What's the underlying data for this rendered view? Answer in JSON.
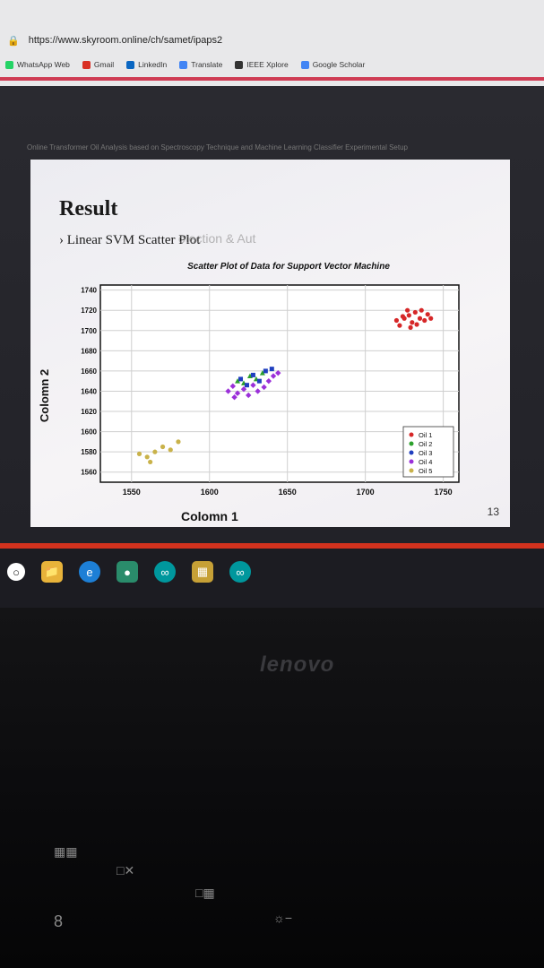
{
  "browser": {
    "url": "https://www.skyroom.online/ch/samet/ipaps2",
    "bookmarks": [
      {
        "label": "WhatsApp Web",
        "color": "#25d366"
      },
      {
        "label": "Gmail",
        "color": "#d93025"
      },
      {
        "label": "LinkedIn",
        "color": "#0a66c2"
      },
      {
        "label": "Translate",
        "color": "#4285f4"
      },
      {
        "label": "IEEE Xplore",
        "color": "#333333"
      },
      {
        "label": "Google Scholar",
        "color": "#4285f4"
      }
    ]
  },
  "document": {
    "title": "Online Transformer Oil Analysis based on Spectroscopy Technique and Machine Learning Classifier Experimental Setup"
  },
  "slide": {
    "heading": "Result",
    "bullet": "› Linear SVM Scatter Plot",
    "watermark": "otection & Aut",
    "page_number": "13"
  },
  "chart_data": {
    "type": "scatter",
    "title": "Scatter Plot of Data for Support Vector Machine",
    "xlabel": "Colomn 1",
    "ylabel": "Colomn 2",
    "xlim": [
      1530,
      1760
    ],
    "ylim": [
      1550,
      1745
    ],
    "x_ticks": [
      "1550",
      "1600",
      "1650",
      "1700",
      "1750"
    ],
    "y_ticks": [
      "1560",
      "1580",
      "1600",
      "1620",
      "1640",
      "1660",
      "1680",
      "1700",
      "1720",
      "1740"
    ],
    "grid": true,
    "legend_position": "bottom-right",
    "series": [
      {
        "name": "Oil 1",
        "color": "#d62728",
        "marker": "circle",
        "points": [
          [
            1720,
            1710
          ],
          [
            1725,
            1712
          ],
          [
            1728,
            1715
          ],
          [
            1730,
            1708
          ],
          [
            1722,
            1705
          ],
          [
            1732,
            1718
          ],
          [
            1735,
            1712
          ],
          [
            1738,
            1710
          ],
          [
            1740,
            1716
          ],
          [
            1727,
            1720
          ],
          [
            1733,
            1706
          ],
          [
            1742,
            1712
          ],
          [
            1736,
            1720
          ],
          [
            1724,
            1714
          ],
          [
            1729,
            1703
          ]
        ]
      },
      {
        "name": "Oil 2",
        "color": "#2ca02c",
        "marker": "triangle",
        "points": [
          [
            1618,
            1650
          ],
          [
            1622,
            1648
          ],
          [
            1626,
            1655
          ],
          [
            1630,
            1652
          ],
          [
            1634,
            1658
          ]
        ]
      },
      {
        "name": "Oil 3",
        "color": "#1f3fbf",
        "marker": "square",
        "points": [
          [
            1620,
            1652
          ],
          [
            1628,
            1656
          ],
          [
            1632,
            1650
          ],
          [
            1636,
            1660
          ],
          [
            1624,
            1646
          ],
          [
            1640,
            1662
          ]
        ]
      },
      {
        "name": "Oil 4",
        "color": "#9b30d9",
        "marker": "diamond",
        "points": [
          [
            1612,
            1640
          ],
          [
            1615,
            1645
          ],
          [
            1618,
            1638
          ],
          [
            1622,
            1642
          ],
          [
            1625,
            1636
          ],
          [
            1628,
            1646
          ],
          [
            1631,
            1640
          ],
          [
            1635,
            1644
          ],
          [
            1638,
            1650
          ],
          [
            1641,
            1655
          ],
          [
            1644,
            1658
          ],
          [
            1616,
            1634
          ]
        ]
      },
      {
        "name": "Oil 5",
        "color": "#c9b24a",
        "marker": "circle",
        "points": [
          [
            1555,
            1578
          ],
          [
            1560,
            1575
          ],
          [
            1565,
            1580
          ],
          [
            1570,
            1585
          ],
          [
            1575,
            1582
          ],
          [
            1580,
            1590
          ],
          [
            1562,
            1570
          ]
        ]
      }
    ]
  }
}
